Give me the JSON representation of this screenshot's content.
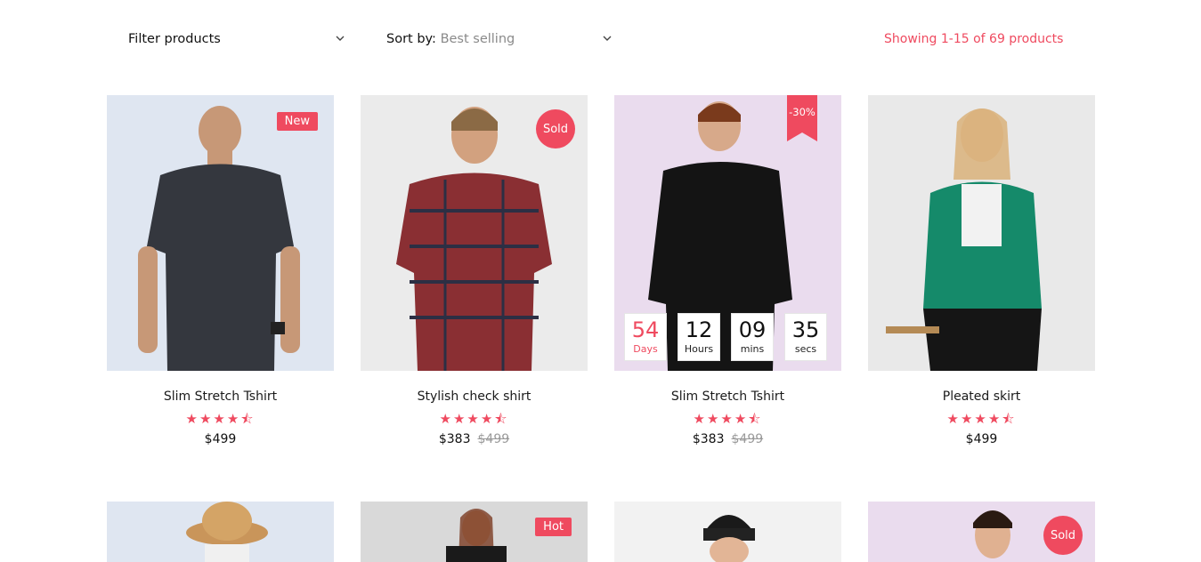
{
  "toolbar": {
    "filter_label": "Filter products",
    "sort_label": "Sort by:",
    "sort_value": "Best selling",
    "showing": "Showing 1-15 of 69 products"
  },
  "colors": {
    "accent": "#ef4a5f"
  },
  "products": [
    {
      "title": "Slim Stretch Tshirt",
      "rating": 4.5,
      "stars": "★★★★⯪",
      "price": "$499",
      "badge": "New"
    },
    {
      "title": "Stylish check shirt",
      "rating": 4.5,
      "stars": "★★★★⯪",
      "price": "$383",
      "old_price": "$499",
      "badge": "Sold"
    },
    {
      "title": "Slim Stretch Tshirt",
      "rating": 4.5,
      "stars": "★★★★⯪",
      "price": "$383",
      "old_price": "$499",
      "badge": "-30%",
      "countdown": [
        {
          "num": "54",
          "label": "Days"
        },
        {
          "num": "12",
          "label": "Hours"
        },
        {
          "num": "09",
          "label": "mins"
        },
        {
          "num": "35",
          "label": "secs"
        }
      ]
    },
    {
      "title": "Pleated skirt",
      "rating": 4.5,
      "stars": "★★★★⯪",
      "price": "$499"
    },
    {
      "badge": ""
    },
    {
      "badge": "Hot"
    },
    {
      "badge": ""
    },
    {
      "badge": "Sold"
    }
  ]
}
